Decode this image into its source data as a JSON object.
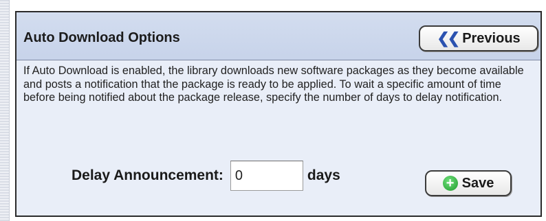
{
  "panel": {
    "title": "Auto Download Options",
    "previous_button": {
      "label": "Previous",
      "icon": "double-chevron-left-icon"
    },
    "description": "If Auto Download is enabled, the library downloads new software packages as they become available and posts a notification that the package is ready to be applied. To wait a specific amount of time before being notified about the package release, specify the number of days to delay notification.",
    "delay": {
      "label": "Delay Announcement:",
      "value": "0",
      "unit": "days"
    },
    "save_button": {
      "label": "Save",
      "icon": "plus-circle-icon"
    }
  },
  "colors": {
    "accent_blue": "#2b52b0",
    "save_green": "#1f9a2d",
    "panel_bg": "#e9eef8",
    "header_bg": "#c7d3ea"
  }
}
